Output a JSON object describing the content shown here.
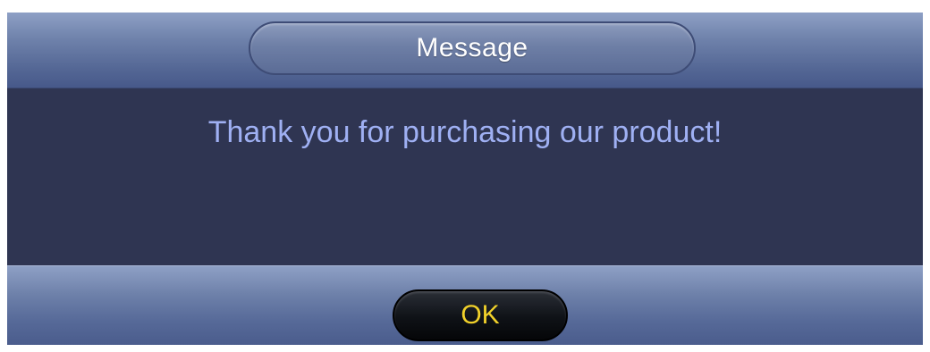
{
  "dialog": {
    "title": "Message",
    "message": "Thank you for purchasing our product!",
    "ok_label": "OK"
  },
  "colors": {
    "dialog_background": "#2f3552",
    "message_text": "#9fb0f3",
    "title_text": "#ffffff",
    "ok_text": "#f1d12a",
    "header_gradient_top": "#8ea0c5",
    "header_gradient_bottom": "#47598a"
  }
}
